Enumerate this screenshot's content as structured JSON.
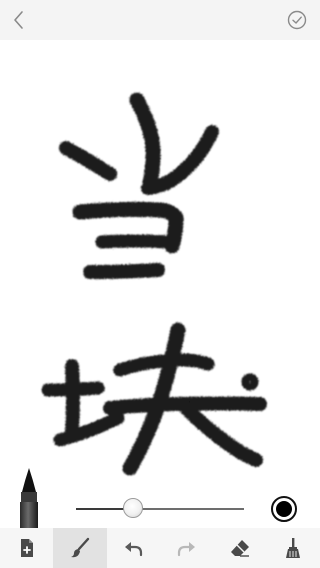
{
  "nav": {
    "back_icon": "chevron-left-icon",
    "done_icon": "check-circle-icon"
  },
  "canvas": {
    "content": "handwritten-characters-drawing"
  },
  "brush": {
    "size_fraction": 0.34,
    "color": "#000000"
  },
  "toolbar": {
    "tools": [
      {
        "name": "new-page",
        "icon": "page-plus-icon",
        "active": false
      },
      {
        "name": "brush",
        "icon": "brush-icon",
        "active": true
      },
      {
        "name": "undo",
        "icon": "undo-icon",
        "active": false
      },
      {
        "name": "redo",
        "icon": "redo-icon",
        "active": false
      },
      {
        "name": "eraser",
        "icon": "eraser-icon",
        "active": false
      },
      {
        "name": "clear",
        "icon": "broom-icon",
        "active": false
      }
    ]
  },
  "colors": {
    "topbar": "#f4f4f4",
    "toolbar": "#f6f6f6",
    "active_tool": "#e2e2e2",
    "icon": "#4a4a4a",
    "icon_disabled": "#b8b8b8"
  }
}
